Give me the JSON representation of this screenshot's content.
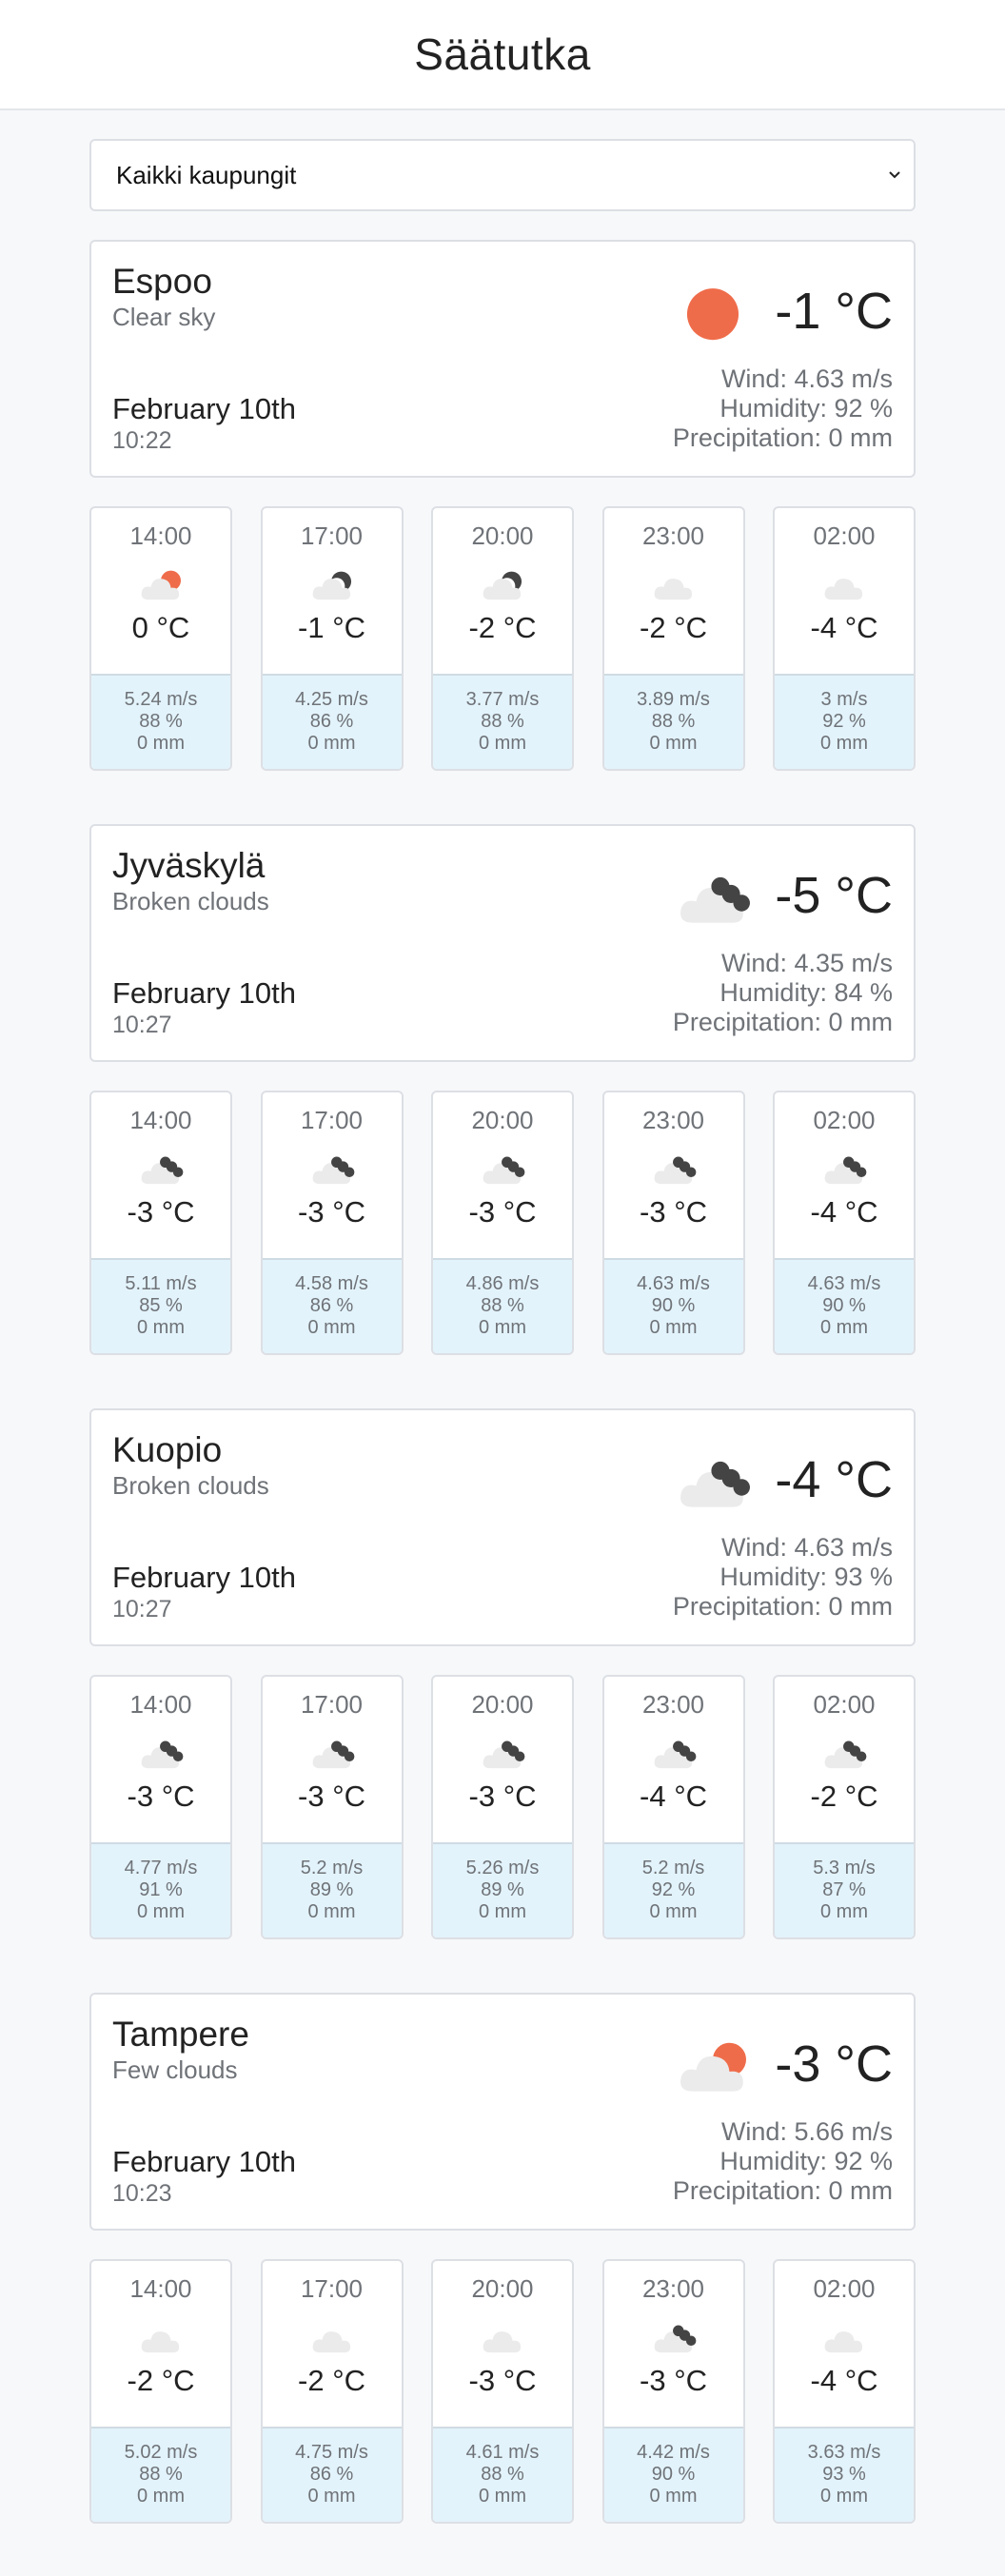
{
  "header": {
    "title": "Säätutka"
  },
  "select": {
    "value": "Kaikki kaupungit"
  },
  "colors": {
    "sun": "#ef6c4a",
    "cloud": "#ebebeb",
    "dark_cloud": "#444444",
    "forecast_bg": "#e3f3fb"
  },
  "cities": [
    {
      "name": "Espoo",
      "description": "Clear sky",
      "date": "February 10th",
      "time": "10:22",
      "temp": "-1 °C",
      "icon": "sun-icon",
      "wind": "Wind: 4.63 m/s",
      "humidity": "Humidity: 92 %",
      "precip": "Precipitation: 0 mm",
      "forecast": [
        {
          "hour": "14:00",
          "icon": "few-clouds-icon",
          "temp": "0 °C",
          "wind": "5.24 m/s",
          "humidity": "88 %",
          "precip": "0 mm"
        },
        {
          "hour": "17:00",
          "icon": "few-clouds-night-icon",
          "temp": "-1 °C",
          "wind": "4.25 m/s",
          "humidity": "86 %",
          "precip": "0 mm"
        },
        {
          "hour": "20:00",
          "icon": "few-clouds-night-icon",
          "temp": "-2 °C",
          "wind": "3.77 m/s",
          "humidity": "88 %",
          "precip": "0 mm"
        },
        {
          "hour": "23:00",
          "icon": "cloud-icon",
          "temp": "-2 °C",
          "wind": "3.89 m/s",
          "humidity": "88 %",
          "precip": "0 mm"
        },
        {
          "hour": "02:00",
          "icon": "cloud-icon",
          "temp": "-4 °C",
          "wind": "3 m/s",
          "humidity": "92 %",
          "precip": "0 mm"
        }
      ]
    },
    {
      "name": "Jyväskylä",
      "description": "Broken clouds",
      "date": "February 10th",
      "time": "10:27",
      "temp": "-5 °C",
      "icon": "broken-clouds-icon",
      "wind": "Wind: 4.35 m/s",
      "humidity": "Humidity: 84 %",
      "precip": "Precipitation: 0 mm",
      "forecast": [
        {
          "hour": "14:00",
          "icon": "broken-clouds-icon",
          "temp": "-3 °C",
          "wind": "5.11 m/s",
          "humidity": "85 %",
          "precip": "0 mm"
        },
        {
          "hour": "17:00",
          "icon": "broken-clouds-icon",
          "temp": "-3 °C",
          "wind": "4.58 m/s",
          "humidity": "86 %",
          "precip": "0 mm"
        },
        {
          "hour": "20:00",
          "icon": "broken-clouds-icon",
          "temp": "-3 °C",
          "wind": "4.86 m/s",
          "humidity": "88 %",
          "precip": "0 mm"
        },
        {
          "hour": "23:00",
          "icon": "broken-clouds-icon",
          "temp": "-3 °C",
          "wind": "4.63 m/s",
          "humidity": "90 %",
          "precip": "0 mm"
        },
        {
          "hour": "02:00",
          "icon": "broken-clouds-icon",
          "temp": "-4 °C",
          "wind": "4.63 m/s",
          "humidity": "90 %",
          "precip": "0 mm"
        }
      ]
    },
    {
      "name": "Kuopio",
      "description": "Broken clouds",
      "date": "February 10th",
      "time": "10:27",
      "temp": "-4 °C",
      "icon": "broken-clouds-icon",
      "wind": "Wind: 4.63 m/s",
      "humidity": "Humidity: 93 %",
      "precip": "Precipitation: 0 mm",
      "forecast": [
        {
          "hour": "14:00",
          "icon": "broken-clouds-icon",
          "temp": "-3 °C",
          "wind": "4.77 m/s",
          "humidity": "91 %",
          "precip": "0 mm"
        },
        {
          "hour": "17:00",
          "icon": "broken-clouds-icon",
          "temp": "-3 °C",
          "wind": "5.2 m/s",
          "humidity": "89 %",
          "precip": "0 mm"
        },
        {
          "hour": "20:00",
          "icon": "broken-clouds-icon",
          "temp": "-3 °C",
          "wind": "5.26 m/s",
          "humidity": "89 %",
          "precip": "0 mm"
        },
        {
          "hour": "23:00",
          "icon": "broken-clouds-icon",
          "temp": "-4 °C",
          "wind": "5.2 m/s",
          "humidity": "92 %",
          "precip": "0 mm"
        },
        {
          "hour": "02:00",
          "icon": "broken-clouds-icon",
          "temp": "-2 °C",
          "wind": "5.3 m/s",
          "humidity": "87 %",
          "precip": "0 mm"
        }
      ]
    },
    {
      "name": "Tampere",
      "description": "Few clouds",
      "date": "February 10th",
      "time": "10:23",
      "temp": "-3 °C",
      "icon": "few-clouds-icon",
      "wind": "Wind: 5.66 m/s",
      "humidity": "Humidity: 92 %",
      "precip": "Precipitation: 0 mm",
      "forecast": [
        {
          "hour": "14:00",
          "icon": "cloud-icon",
          "temp": "-2 °C",
          "wind": "5.02 m/s",
          "humidity": "88 %",
          "precip": "0 mm"
        },
        {
          "hour": "17:00",
          "icon": "cloud-icon",
          "temp": "-2 °C",
          "wind": "4.75 m/s",
          "humidity": "86 %",
          "precip": "0 mm"
        },
        {
          "hour": "20:00",
          "icon": "cloud-icon",
          "temp": "-3 °C",
          "wind": "4.61 m/s",
          "humidity": "88 %",
          "precip": "0 mm"
        },
        {
          "hour": "23:00",
          "icon": "broken-clouds-icon",
          "temp": "-3 °C",
          "wind": "4.42 m/s",
          "humidity": "90 %",
          "precip": "0 mm"
        },
        {
          "hour": "02:00",
          "icon": "cloud-icon",
          "temp": "-4 °C",
          "wind": "3.63 m/s",
          "humidity": "93 %",
          "precip": "0 mm"
        }
      ]
    }
  ]
}
